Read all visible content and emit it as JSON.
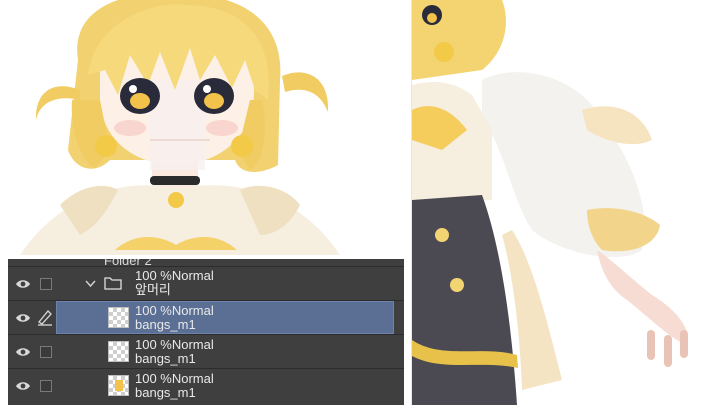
{
  "layer_panel": {
    "partial_top_label": "Folder 2",
    "layers": [
      {
        "line1": "100 %Normal",
        "line2": "앞머리",
        "type": "folder",
        "selected": false
      },
      {
        "line1": "100 %Normal",
        "line2": "bangs_m1",
        "type": "raster",
        "selected": true
      },
      {
        "line1": "100 %Normal",
        "line2": "bangs_m1",
        "type": "raster",
        "selected": false
      },
      {
        "line1": "100 %Normal",
        "line2": "bangs_m1",
        "type": "raster",
        "selected": false
      }
    ]
  },
  "colors": {
    "panel_bg": "#3f3f3f",
    "selected_row": "#5a6f93",
    "hair": "#f3d574",
    "hair_dark": "#e0b34a"
  }
}
